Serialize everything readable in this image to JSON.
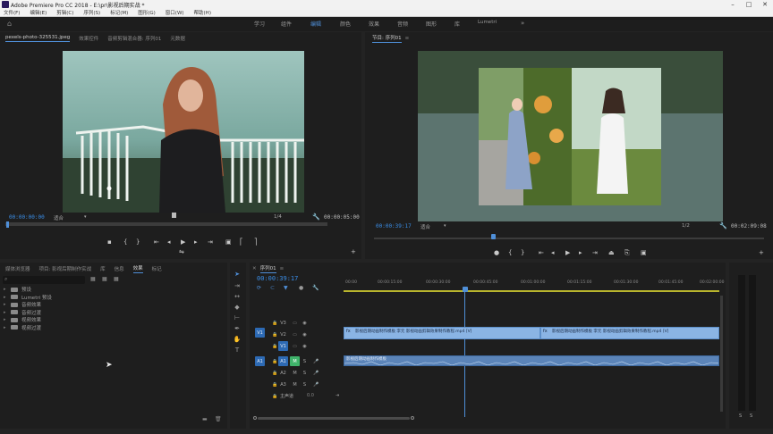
{
  "titlebar": {
    "title": "Adobe Premiere Pro CC 2018 - E:\\pr\\影视后期实战 *"
  },
  "menus": [
    "文件(F)",
    "编辑(E)",
    "剪辑(C)",
    "序列(S)",
    "标记(M)",
    "图形(G)",
    "窗口(W)",
    "帮助(H)"
  ],
  "workspaces": [
    "学习",
    "组件",
    "编辑",
    "颜色",
    "效果",
    "音频",
    "图形",
    "库",
    "Lumetri"
  ],
  "source": {
    "tabs": [
      "pexels-photo-325531.jpeg",
      "效果控件",
      "音频剪辑混合器: 序列01",
      "元数据"
    ],
    "timecode_in": "00:00:00:00",
    "fit": "适合",
    "fraction": "1/4",
    "timecode_dur": "00:00:05:00"
  },
  "program": {
    "tab": "节目: 序列01",
    "timecode": "00:00:39:17",
    "fit": "适合",
    "fraction": "1/2",
    "timecode_dur": "00:02:09:08"
  },
  "project": {
    "tabs": [
      "媒体浏览器",
      "项目: 影视后期制作实战",
      "库",
      "信息",
      "效果",
      "标记"
    ],
    "tree": [
      "预设",
      "Lumetri 预设",
      "音频效果",
      "音频过渡",
      "视频效果",
      "视频过渡"
    ]
  },
  "timeline": {
    "tab": "序列01",
    "timecode": "00:00:39:17",
    "ruler": [
      "00:00",
      "00:00:15:00",
      "00:00:30:00",
      "00:00:45:00",
      "00:01:00:00",
      "00:01:15:00",
      "00:01:30:00",
      "00:01:45:00",
      "00:02:00:00"
    ],
    "tracks": [
      "V3",
      "V2",
      "V1",
      "A1",
      "A2",
      "A3"
    ],
    "v1": "V1",
    "a1": "A1",
    "master": "主声道",
    "master_val": "0.0",
    "clip_video_1": "影视后期动画制作模板 李元 影视动画剪辑效果制作教程.mp4 [V]",
    "clip_video_2": "影视后期动画制作模板 李元 影视动画剪辑效果制作教程.mp4 [V]",
    "clip_audio": "影视后期动画制作模板"
  },
  "meter": {
    "labels": [
      "S",
      "S"
    ]
  }
}
